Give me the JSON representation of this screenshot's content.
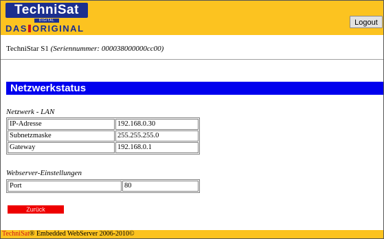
{
  "header": {
    "logo_top": "TechniSat",
    "logo_digital": "DIGITAL",
    "logo_das": "DAS",
    "logo_original": "ORIGINAL",
    "logout_label": "Logout"
  },
  "device": {
    "name": "TechniStar S1",
    "serial": "(Seriennummer: 000038000000cc00)"
  },
  "title": "Netzwerkstatus",
  "lan": {
    "label": "Netzwerk - LAN",
    "rows": [
      {
        "key": "IP-Adresse",
        "value": "192.168.0.30"
      },
      {
        "key": "Subnetzmaske",
        "value": "255.255.255.0"
      },
      {
        "key": "Gateway",
        "value": "192.168.0.1"
      }
    ]
  },
  "webserver": {
    "label": "Webserver-Einstellungen",
    "rows": [
      {
        "key": "Port",
        "value": "80"
      }
    ]
  },
  "back_label": "Zurück",
  "footer": {
    "brand": "TechniSat",
    "text": "® Embedded WebServer 2006-2010©"
  },
  "colors": {
    "header_bg": "#fcc320",
    "title_bg": "#0000ee",
    "back_bg": "#ee0000",
    "brand_blue": "#1b2f8f",
    "brand_red": "#d01818"
  }
}
